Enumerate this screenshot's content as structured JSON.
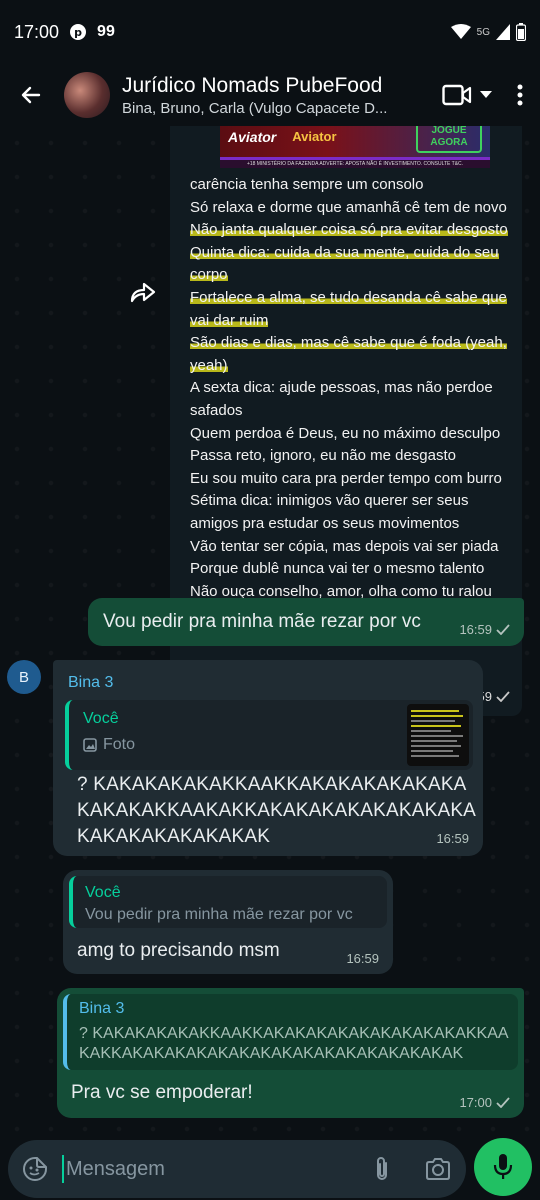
{
  "status_bar": {
    "time": "17:00",
    "app_badge": "99",
    "network": "5G",
    "icons": [
      "pinterest-icon",
      "wifi-icon",
      "signal-icon",
      "battery-icon"
    ]
  },
  "header": {
    "title": "Jurídico Nomads PubeFood",
    "subtitle": "Bina, Bruno, Carla (Vulgo Capacete D...",
    "icons": [
      "back-arrow-icon",
      "video-call-icon",
      "chevron-down-icon",
      "more-vert-icon"
    ]
  },
  "forwarded_image": {
    "ad": {
      "logo": "Aviator",
      "name": "Aviator",
      "cta_line1": "JOGUE",
      "cta_line2": "AGORA",
      "disclaimer": "+18 MINISTÉRIO DA FAZENDA ADVERTE: APOSTA NÃO É INVESTIMENTO. CONSULTE T&C."
    },
    "lyrics": [
      {
        "text": "carência tenha sempre um consolo",
        "highlight": false
      },
      {
        "text": "Só relaxa e dorme que amanhã cê tem de novo",
        "highlight": false
      },
      {
        "text": "Não janta qualquer coisa só pra evitar desgosto",
        "highlight": true
      },
      {
        "text": "Quinta dica: cuida da sua mente, cuida do seu",
        "highlight": true
      },
      {
        "text": "corpo",
        "highlight": true
      },
      {
        "text": "Fortalece a alma, se tudo desanda cê sabe que",
        "highlight": true
      },
      {
        "text": "vai dar ruim",
        "highlight": true
      },
      {
        "text": "São dias e dias, mas cê sabe que é foda (yeah,",
        "highlight": true
      },
      {
        "text": "yeah)",
        "highlight": true
      },
      {
        "text": "A sexta dica: ajude pessoas, mas não perdoe",
        "highlight": false
      },
      {
        "text": "safados",
        "highlight": false
      },
      {
        "text": "Quem perdoa é Deus, eu no máximo desculpo",
        "highlight": false
      },
      {
        "text": "Passa reto, ignoro, eu não me desgasto",
        "highlight": false
      },
      {
        "text": "Eu sou muito cara pra perder tempo com burro",
        "highlight": false
      },
      {
        "text": "Sétima dica: inimigos vão querer ser seus",
        "highlight": false
      },
      {
        "text": "amigos pra estudar os seus movimentos",
        "highlight": false
      },
      {
        "text": "Vão tentar ser cópia, mas depois vai ser piada",
        "highlight": false
      },
      {
        "text": "Porque dublê nunca vai ter o mesmo talento",
        "highlight": false
      },
      {
        "text": "Não ouça conselho, amor, olha como tu ralou",
        "highlight": false
      }
    ],
    "time": "16:59"
  },
  "messages": [
    {
      "id": "msg1",
      "direction": "out",
      "text": "Vou pedir pra minha mãe rezar por vc",
      "time": "16:59"
    },
    {
      "id": "msg2",
      "direction": "in",
      "avatar_letter": "B",
      "sender": "Bina 3",
      "quote_author": "Você",
      "quote_text": "Foto",
      "text": "? KAKAKAKAKAKKAAKKAKAKAKAKAKAKAKAKAKAKKAAKAKKAKAKAKAKAKAKAKAKAKAKAKAKAKAKAKAK",
      "time": "16:59"
    },
    {
      "id": "msg3",
      "direction": "in",
      "quote_author": "Você",
      "quote_text": "Vou pedir pra minha mãe rezar por vc",
      "text": "amg to precisando msm",
      "time": "16:59"
    },
    {
      "id": "msg4",
      "direction": "out",
      "quote_author": "Bina 3",
      "quote_text": "? KAKAKAKAKAKKAAKKAKAKAKAKAKAKAKAKAKAKKAAKAKKAKAKAKAKAKAKAKAKAKAKAKAKAKAKAKAK",
      "text": "Pra vc se empoderar!",
      "time": "17:00"
    }
  ],
  "input": {
    "placeholder": "Mensagem",
    "icons": [
      "sticker-icon",
      "attach-icon",
      "camera-icon",
      "mic-icon"
    ]
  },
  "colors": {
    "background": "#0b1014",
    "outgoing_bubble": "#144d37",
    "incoming_bubble": "#202c33",
    "accent_green": "#21c063",
    "sender_blue": "#53bdeb",
    "highlight_yellow": "#d6d419"
  }
}
